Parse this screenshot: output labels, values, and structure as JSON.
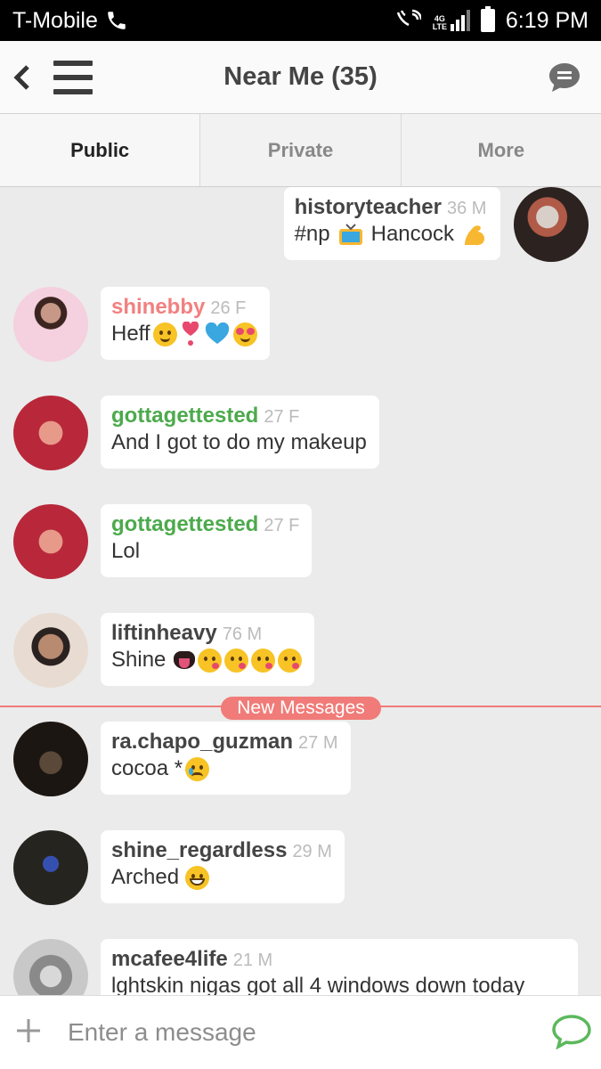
{
  "status_bar": {
    "carrier": "T-Mobile",
    "network": "4G LTE",
    "time": "6:19 PM"
  },
  "header": {
    "title": "Near Me (35)"
  },
  "tabs": [
    {
      "label": "Public",
      "active": true
    },
    {
      "label": "Private",
      "active": false
    },
    {
      "label": "More",
      "active": false
    }
  ],
  "messages": [
    {
      "user": "historyteacher",
      "meta": "36 M",
      "text": "#np",
      "text2": "Hancock",
      "side": "right",
      "name_color": "#444444",
      "emojis": [
        "tv-emoji",
        "flexed-bicep-emoji"
      ]
    },
    {
      "user": "shinebby",
      "meta": "26 F",
      "text": "Heff",
      "side": "left",
      "name_color": "#f28080",
      "emojis": [
        "hugging-face-emoji",
        "heart-exclamation-emoji",
        "blue-heart-emoji",
        "heart-eyes-emoji"
      ]
    },
    {
      "user": "gottagettested",
      "meta": "27 F",
      "text": "And I got to do my makeup",
      "side": "left",
      "name_color": "#4caa4c"
    },
    {
      "user": "gottagettested",
      "meta": "27 F",
      "text": "Lol",
      "side": "left",
      "name_color": "#4caa4c"
    },
    {
      "user": "liftinheavy",
      "meta": "76 M",
      "text": "Shine",
      "side": "left",
      "name_color": "#444444",
      "emojis": [
        "tongue-emoji",
        "kissing-face-emoji",
        "kissing-face-emoji",
        "kissing-face-emoji",
        "kissing-face-emoji"
      ]
    },
    {
      "user": "ra.chapo_guzman",
      "meta": "27 M",
      "text": "cocoa *",
      "side": "left",
      "name_color": "#444444",
      "emojis": [
        "sad-face-emoji"
      ]
    },
    {
      "user": "shine_regardless",
      "meta": "29 M",
      "text": "Arched",
      "side": "left",
      "name_color": "#444444",
      "emojis": [
        "grinning-face-emoji"
      ]
    },
    {
      "user": "mcafee4life",
      "meta": "21 M",
      "text": "lghtskin nigas got all 4 windows down today",
      "side": "left",
      "name_color": "#444444"
    }
  ],
  "divider": {
    "label": "New Messages"
  },
  "composer": {
    "placeholder": "Enter a message"
  },
  "colors": {
    "accent": "#f07b78",
    "green": "#4caa4c",
    "pink": "#f28080",
    "send": "#5cb85c"
  }
}
